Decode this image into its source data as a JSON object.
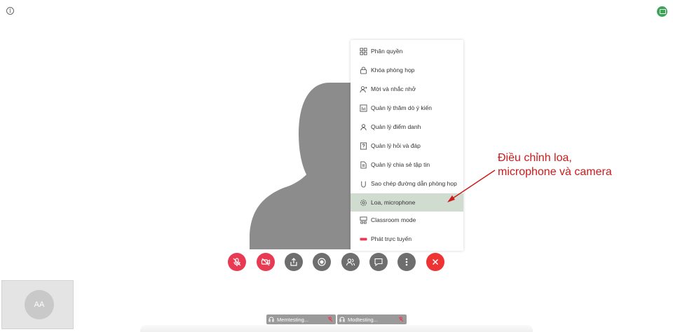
{
  "menu": {
    "items": [
      {
        "label": "Phân quyền",
        "icon": "permissions-icon"
      },
      {
        "label": "Khóa phòng họp",
        "icon": "lock-icon"
      },
      {
        "label": "Mời và nhắc nhở",
        "icon": "invite-user-icon"
      },
      {
        "label": "Quản lý thăm dò ý kiến",
        "icon": "poll-icon"
      },
      {
        "label": "Quản lý điểm danh",
        "icon": "attendance-icon"
      },
      {
        "label": "Quản lý hỏi và đáp",
        "icon": "qa-icon"
      },
      {
        "label": "Quản lý chia sẻ tập tin",
        "icon": "file-share-icon"
      },
      {
        "label": "Sao chép đường dẫn phòng họp",
        "icon": "copy-link-icon"
      },
      {
        "label": "Loa, microphone",
        "icon": "gear-icon",
        "selected": true
      },
      {
        "label": "Classroom mode",
        "icon": "classroom-icon"
      },
      {
        "label": "Phát trực tuyến",
        "icon": "live-icon"
      }
    ]
  },
  "annotation": {
    "line1": "Điều chỉnh loa,",
    "line2": "microphone và camera",
    "color": "#cc1b1b"
  },
  "toolbar": [
    {
      "name": "mic-toggle-button",
      "icon": "mic-off-icon"
    },
    {
      "name": "camera-toggle-button",
      "icon": "camera-off-icon"
    },
    {
      "name": "share-button",
      "icon": "share-icon"
    },
    {
      "name": "record-button",
      "icon": "record-icon"
    },
    {
      "name": "participants-button",
      "icon": "participants-icon"
    },
    {
      "name": "chat-button",
      "icon": "chat-icon"
    },
    {
      "name": "more-options-button",
      "icon": "more-vertical-icon"
    },
    {
      "name": "leave-button",
      "icon": "close-icon"
    }
  ],
  "self_view": {
    "initials": "AA"
  },
  "participants": [
    {
      "name": "Memtesting..."
    },
    {
      "name": "Modtesting..."
    }
  ],
  "colors": {
    "mute_red": "#e83b53",
    "leave_red": "#ee3334",
    "menu_selected": "#d1dcd0",
    "status_green": "#3aa655"
  }
}
